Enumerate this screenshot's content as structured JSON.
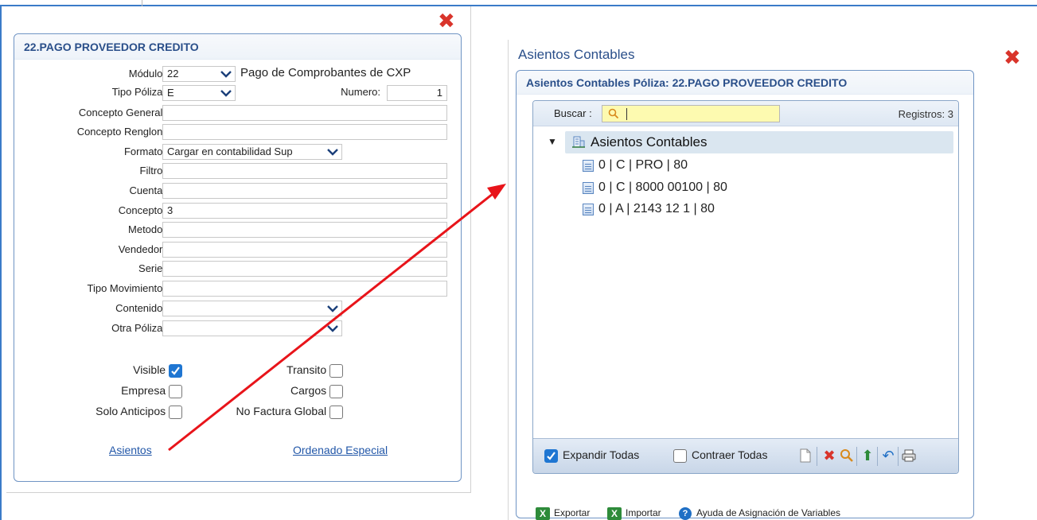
{
  "left": {
    "title": "22.PAGO PROVEEDOR CREDITO",
    "fields": {
      "modulo_label": "Módulo:",
      "modulo_value": "22",
      "modulo_desc": "Pago de Comprobantes de CXP",
      "tipo_poliza_label": "Tipo Póliza:",
      "tipo_poliza_value": "E",
      "numero_label": "Numero:",
      "numero_value": "1",
      "concepto_general_label": "Concepto General:",
      "concepto_renglon_label": "Concepto Renglon:",
      "formato_label": "Formato:",
      "formato_value": "Cargar en contabilidad Sup",
      "filtro_label": "Filtro:",
      "cuenta_label": "Cuenta:",
      "concepto_label": "Concepto:",
      "concepto_value": "3",
      "metodo_label": "Metodo:",
      "vendedor_label": "Vendedor:",
      "serie_label": "Serie:",
      "tipo_movimiento_label": "Tipo Movimiento:",
      "contenido_label": "Contenido:",
      "otra_poliza_label": "Otra Póliza:"
    },
    "checkboxes": {
      "visible": "Visible",
      "empresa": "Empresa",
      "solo_anticipos": "Solo Anticipos",
      "transito": "Transito",
      "cargos": "Cargos",
      "no_factura_global": "No Factura Global"
    },
    "links": {
      "asientos": "Asientos",
      "ordenado_especial": "Ordenado Especial"
    }
  },
  "right": {
    "window_title": "Asientos Contables",
    "panel_title": "Asientos Contables Póliza: 22.PAGO PROVEEDOR CREDITO",
    "search_label": "Buscar :",
    "registros": "Registros: 3",
    "tree_root": "Asientos Contables",
    "tree_items": [
      "0 | C | PRO | 80",
      "0 | C | 8000 00100 | 80",
      "0 | A | 2143 12 1 | 80"
    ],
    "expandir": "Expandir Todas",
    "contraer": "Contraer Todas",
    "exportar": "Exportar",
    "importar": "Importar",
    "ayuda": "Ayuda de Asignación de Variables"
  },
  "colors": {
    "accent": "#2a4f8a",
    "close": "#d9342b",
    "arrow": "#e8141a",
    "search_bg": "#fdfab0"
  }
}
